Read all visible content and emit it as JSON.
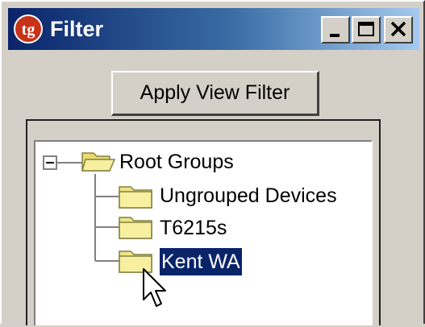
{
  "window": {
    "title": "Filter",
    "icon": "tg-app-icon",
    "controls": [
      "minimize",
      "maximize",
      "close"
    ]
  },
  "toolbar": {
    "apply_label": "Apply View Filter"
  },
  "tree": {
    "root": {
      "label": "Root Groups",
      "expanded": true,
      "toggle": "⊟"
    },
    "children": [
      {
        "label": "Ungrouped Devices",
        "selected": false
      },
      {
        "label": "T6215s",
        "selected": false
      },
      {
        "label": "Kent WA",
        "selected": true
      }
    ]
  },
  "colors": {
    "title_active": "#0a246a",
    "selection": "#0a246a",
    "face": "#d4d0c8"
  }
}
